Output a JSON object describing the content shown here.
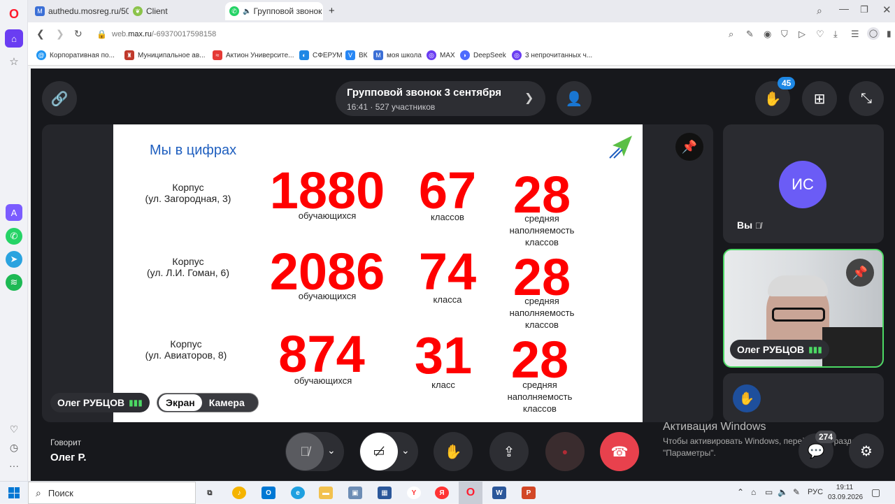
{
  "colors": {
    "opera_red": "#ff1b2d",
    "slide_red": "#ff0000",
    "slide_blue": "#1f5fbf",
    "speaking_green": "#4cd964",
    "badge_blue": "#1e88e5",
    "end_call": "#e8414d"
  },
  "tabs": [
    {
      "label": "authedu.mosreg.ru/50/",
      "icon": "mosreg-icon"
    },
    {
      "label": "Client",
      "icon": "leaf-icon"
    },
    {
      "label": "Групповой звонок 3",
      "icon": "max-icon"
    }
  ],
  "address": {
    "url_prefix": "web.",
    "url_domain": "max.ru",
    "url_rest": "/-69370017598158"
  },
  "bookmarks": [
    "Корпоративная по...",
    "Муниципальное ав...",
    "Актион Университе...",
    "СФЕРУМ",
    "ВК",
    "моя школа",
    "MAX",
    "DeepSeek",
    "3 непрочитанных ч..."
  ],
  "call": {
    "title": "Групповой звонок 3 сентября",
    "time": "16:41",
    "participants": "527 участников",
    "raised_hands": "45",
    "chat_count": "274",
    "speaking_label": "Говорит",
    "speaking_name": "Олег Р."
  },
  "slide": {
    "title": "Мы в цифрах",
    "rows": [
      {
        "corpus_line1": "Корпус",
        "corpus_line2": "(ул. Загородная, 3)",
        "students": "1880",
        "students_label": "обучающихся",
        "classes": "67",
        "classes_label": "классов",
        "avg": "28",
        "avg_label": "средняя наполняемость классов"
      },
      {
        "corpus_line1": "Корпус",
        "corpus_line2": "(ул. Л.И. Гоман, 6)",
        "students": "2086",
        "students_label": "обучающихся",
        "classes": "74",
        "classes_label": "класса",
        "avg": "28",
        "avg_label": "средняя наполняемость классов"
      },
      {
        "corpus_line1": "Корпус",
        "corpus_line2": "(ул. Авиаторов, 8)",
        "students": "874",
        "students_label": "обучающихся",
        "classes": "31",
        "classes_label": "класс",
        "avg": "28",
        "avg_label": "средняя наполняемость классов"
      }
    ]
  },
  "main_tile": {
    "speaker_name": "Олег РУБЦОВ",
    "toggle_screen": "Экран",
    "toggle_camera": "Камера"
  },
  "side_tiles": {
    "me_initials": "ИС",
    "me_label": "Вы",
    "speaker_name": "Олег РУБЦОВ"
  },
  "watermark": {
    "line1": "Активация Windows",
    "line2": "Чтобы активировать Windows, перейдите в разде",
    "line3": "\"Параметры\"."
  },
  "taskbar": {
    "search": "Поиск",
    "lang": "РУС",
    "time": "19:11",
    "date": "03.09.2026"
  }
}
